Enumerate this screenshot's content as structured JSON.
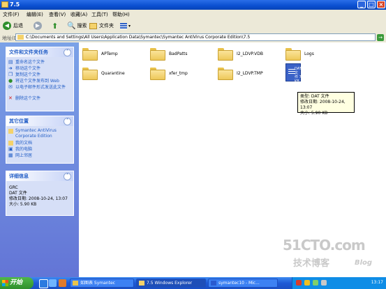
{
  "window": {
    "title": "7.5"
  },
  "menu": [
    "文件(F)",
    "编辑(E)",
    "查看(V)",
    "收藏(A)",
    "工具(T)",
    "帮助(H)"
  ],
  "toolbar": {
    "back": "后退",
    "search": "搜索",
    "folders": "文件夹"
  },
  "address": {
    "label": "地址(D)",
    "path": "C:\\Documents and Settings\\All Users\\Application Data\\Symantec\\Symantec AntiVirus Corporate Edition\\7.5"
  },
  "sidebar": {
    "tasks": {
      "title": "文件和文件夹任务",
      "items": [
        "重命名这个文件",
        "移动这个文件",
        "复制这个文件",
        "将这个文件发布到 Web",
        "以电子邮件形式发送此文件",
        "删除这个文件"
      ]
    },
    "other": {
      "title": "其它位置",
      "items": [
        "Symantec AntiVirus Corporate Edition",
        "我的文档",
        "我的电脑",
        "网上邻居"
      ]
    },
    "details": {
      "title": "详细信息",
      "name": "GRC",
      "type": "DAT 文件",
      "modified": "修改日期: 2008-10-24, 13:07",
      "size": "大小: 5.90 KB"
    }
  },
  "files": [
    {
      "name": "APTemp"
    },
    {
      "name": "BadPatts"
    },
    {
      "name": "I2_LDVP.VDB"
    },
    {
      "name": "Logs"
    },
    {
      "name": "Quarantine"
    },
    {
      "name": "xfer_tmp"
    },
    {
      "name": "I2_LDVP.TMP"
    },
    {
      "name": "GRC.DAT",
      "icon_label": "DAT 文件 7 KB"
    }
  ],
  "tooltip": {
    "type": "类型: DAT 文件",
    "modified": "修改日期: 2008-10-24, 13:07",
    "size": "大小: 5.90 KB"
  },
  "taskbar": {
    "start": "开始",
    "tasks": [
      "如图表 Symantec",
      "7.5 Windows Explorer",
      "symantec10 - Mic..."
    ],
    "clock": "13:17"
  },
  "watermark": {
    "main": "51CTO.com",
    "sub": "技术博客",
    "blog": "Blog"
  }
}
